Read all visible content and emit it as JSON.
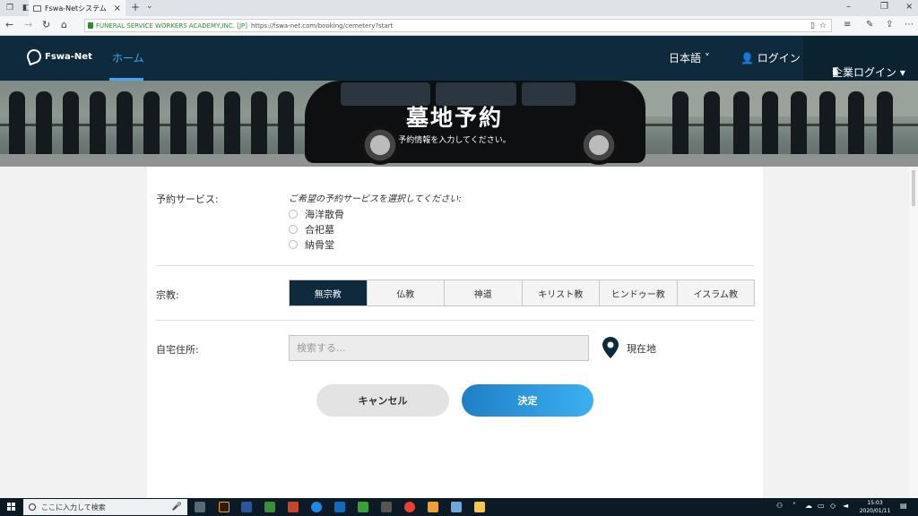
{
  "browser": {
    "tab_title": "Fswa-Netシステム",
    "url_org": "FUNERAL SERVICE WORKERS ACADEMY,INC. [JP]",
    "url_address": "https://fswa-net.com/booking/cemetery?start"
  },
  "header": {
    "logo": "Fswa-Net",
    "nav_home": "ホーム",
    "language": "日本語 ˅",
    "login": "ログイン",
    "corporate_login": "企業ログイン ▾"
  },
  "banner": {
    "title": "墓地予約",
    "subtitle": "予約情報を入力してください。"
  },
  "form": {
    "service_label": "予約サービス:",
    "service_hint": "ご希望の予約サービスを選択してください:",
    "services": [
      "海洋散骨",
      "合祀墓",
      "納骨堂"
    ],
    "religion_label": "宗教:",
    "religions": [
      "無宗教",
      "仏教",
      "神道",
      "キリスト教",
      "ヒンドゥー教",
      "イスラム教"
    ],
    "religion_selected": "無宗教",
    "address_label": "自宅住所:",
    "address_placeholder": "検索する...",
    "current_location": "現在地",
    "cancel": "キャンセル",
    "submit": "決定"
  },
  "taskbar": {
    "search_placeholder": "ここに入力して検索",
    "time": "15:03",
    "date": "2020/01/11"
  },
  "colors": {
    "header_bg": "#0f2a3c",
    "accent": "#3fa9f5",
    "submit_gradient_start": "#1f7fc4",
    "submit_gradient_end": "#3ab0f2"
  }
}
